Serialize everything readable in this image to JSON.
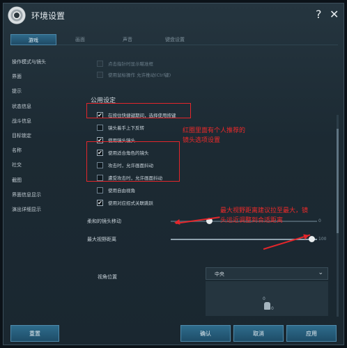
{
  "window": {
    "title": "环境设置",
    "help": "?",
    "close": "✕"
  },
  "tabs": [
    "游戏",
    "画面",
    "声音",
    "键盘设置"
  ],
  "sidebar": {
    "items": [
      "操作模式与镜头",
      "界面",
      "提示",
      "状态信息",
      "战斗信息",
      "目标锁定",
      "名称",
      "社交",
      "截图",
      "界面信息显示",
      "演出详细显示"
    ]
  },
  "content": {
    "top_options": [
      {
        "label": "点击指针时显示瞄准框",
        "checked": false,
        "dim": true
      },
      {
        "label": "使用鼠标操作    允许推动(Ctrl键)",
        "checked": false,
        "dim": true
      }
    ],
    "section_title": "公用设定",
    "options": [
      {
        "label": "在按住快捷键期间，选择使用按键",
        "checked": true
      },
      {
        "label": "镜头着手上下反转",
        "checked": false
      },
      {
        "label": "使用镜头镜头",
        "checked": true
      },
      {
        "label": "使用适合角色的镜头",
        "checked": true
      },
      {
        "label": "攻击时，允许画面抖动",
        "checked": false
      },
      {
        "label": "遭受攻击时，允许画面抖动",
        "checked": false
      },
      {
        "label": "使用自由视角",
        "checked": false
      },
      {
        "label": "使用对应招式关联跳跃",
        "checked": true
      }
    ],
    "sliders": [
      {
        "label": "柔和的镜头移动",
        "value_text": "0",
        "value": 0.0
      },
      {
        "label": "最大视野距离",
        "value_text": "100",
        "value": 1.0
      }
    ],
    "camera_position": {
      "label": "视角位置",
      "value": "中央",
      "preview_top": "0",
      "preview_bottom": "0"
    }
  },
  "buttons": {
    "reset": "重置",
    "ok": "确认",
    "cancel": "取消",
    "apply": "应用"
  },
  "annotations": {
    "note1": "红圈里面有个人推荐的镜头选项设置",
    "note2": "最大视野距离建议拉至最大，镜头远近调整到合适距离"
  },
  "colors": {
    "accent": "#2e6c8c",
    "annotation": "#e4262b",
    "window_bg": "#1c2a33"
  }
}
